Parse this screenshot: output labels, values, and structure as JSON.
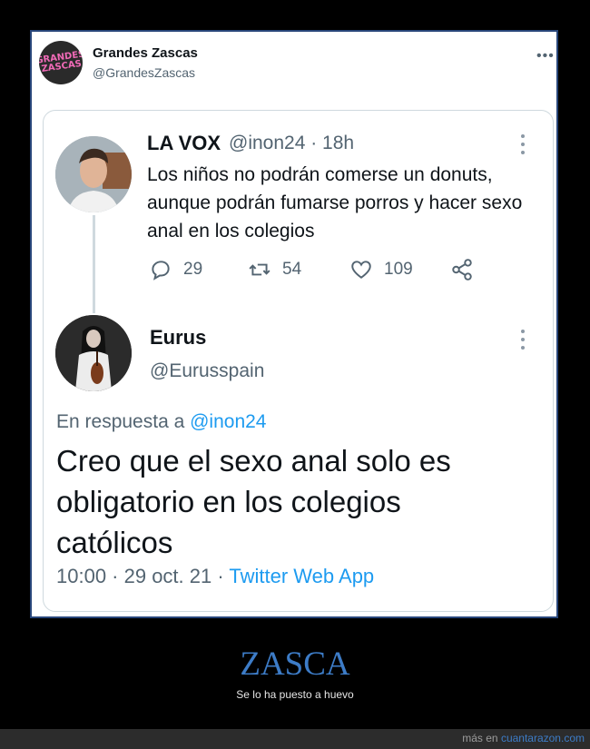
{
  "outer_tweet": {
    "avatar_logo": "GRANDES ZASCAS",
    "name": "Grandes Zascas",
    "handle": "@GrandesZascas",
    "more_icon": "ellipsis-icon"
  },
  "tweet1": {
    "name": "LA VOX",
    "meta": "@inon24 · 18h",
    "text": "Los niños no podrán comerse un donuts, aunque podrán fumarse porros y hacer sexo anal en los colegios",
    "actions": {
      "replies": "29",
      "retweets": "54",
      "likes": "109"
    }
  },
  "tweet2": {
    "name": "Eurus",
    "handle": "@Eurusspain",
    "reply_prefix": "En respuesta a",
    "reply_handle": "@inon24",
    "text": "Creo que el sexo anal solo es obligatorio en los colegios católicos",
    "timestamp": "10:00 · 29 oct. 21 · ",
    "source": "Twitter Web App"
  },
  "footer": {
    "title": "ZASCA",
    "subtitle": "Se lo ha puesto a huevo",
    "credit_prefix": "más en ",
    "credit_link": "cuantarazon.com"
  },
  "colors": {
    "link": "#1d9bf0",
    "footer_title": "#3d7cc7",
    "card_border": "#28467a"
  }
}
